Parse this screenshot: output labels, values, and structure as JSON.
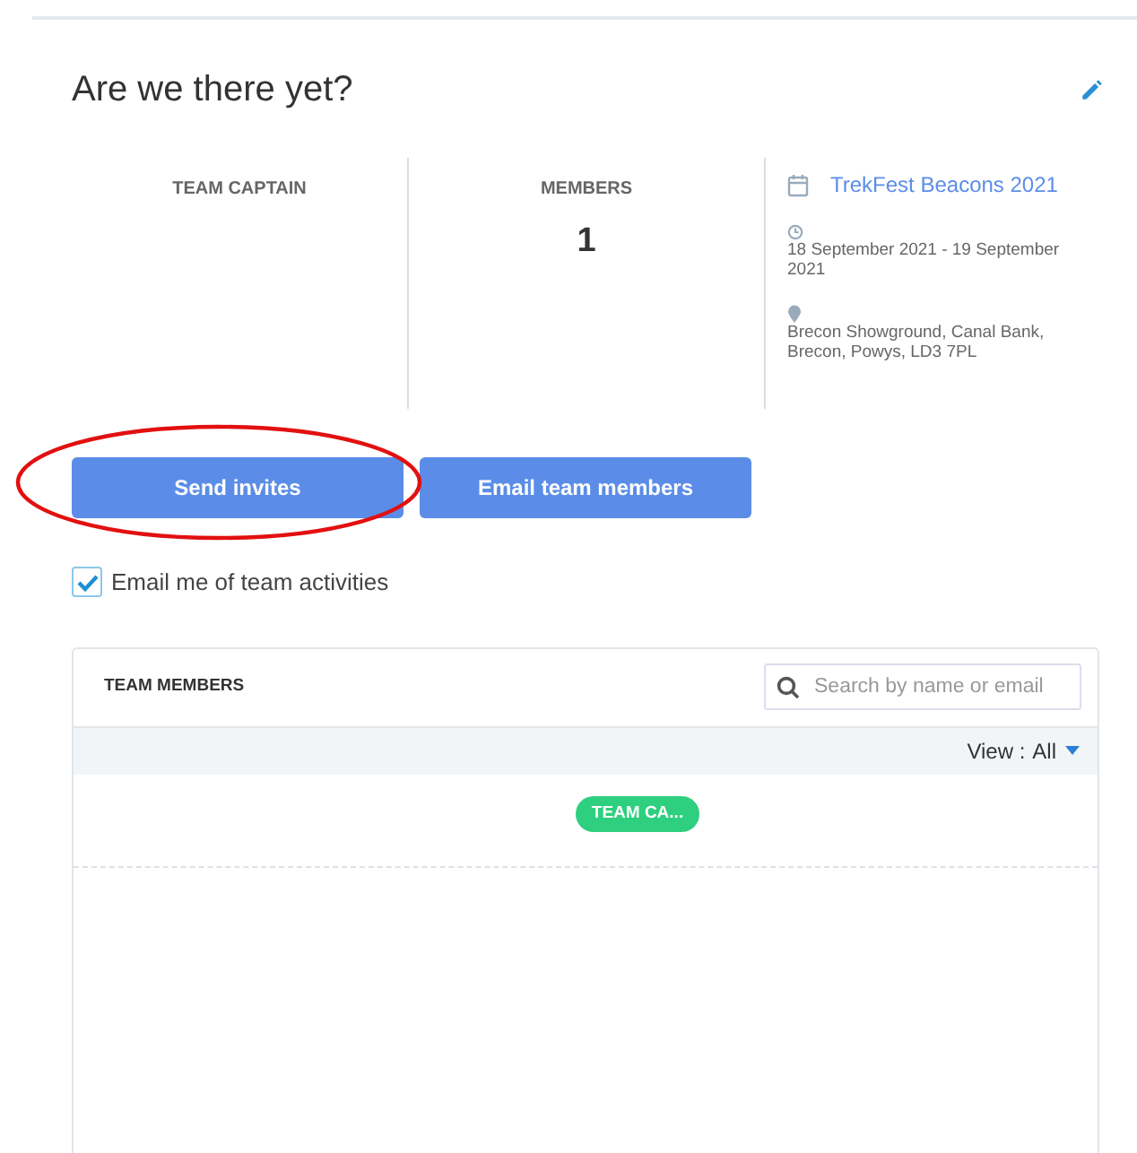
{
  "title": "Are we there yet?",
  "stats": [
    {
      "label": "TEAM CAPTAIN"
    },
    {
      "label": "MEMBERS",
      "value": "1"
    }
  ],
  "event": {
    "name": "TrekFest Beacons 2021",
    "dates": "18 September 2021 - 19 September 2021",
    "location": "Brecon Showground, Canal Bank, Brecon, Powys, LD3 7PL"
  },
  "buttons": [
    "Send invites",
    "Email team members"
  ],
  "email_me": {
    "label": "Email me of team activities",
    "checked": true
  },
  "team_members": {
    "title": "TEAM MEMBERS",
    "search": {
      "placeholder": "Search by name or email"
    },
    "view_label": "View :",
    "view_value": "All",
    "rows": [
      {
        "badge": "TEAM CA..."
      }
    ]
  }
}
